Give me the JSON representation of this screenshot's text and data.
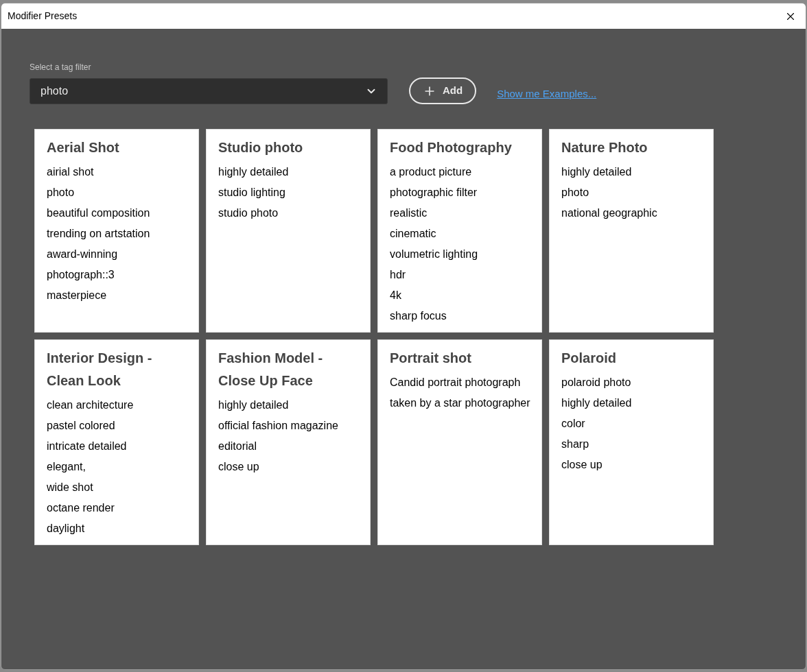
{
  "window": {
    "title": "Modifier Presets"
  },
  "filter": {
    "label": "Select a tag filter",
    "value": "photo"
  },
  "add_button": {
    "label": "Add"
  },
  "examples_link": "Show me Examples...",
  "presets": [
    {
      "title": "Aerial Shot",
      "modifiers": [
        "airial shot",
        "photo",
        "beautiful composition",
        "trending on artstation",
        "award-winning",
        "photograph::3",
        "masterpiece"
      ]
    },
    {
      "title": "Studio photo",
      "modifiers": [
        "highly detailed",
        "studio lighting",
        "studio photo"
      ]
    },
    {
      "title": "Food Photography",
      "modifiers": [
        "a product picture",
        "photographic filter",
        "realistic",
        "cinematic",
        "volumetric lighting",
        "hdr",
        "4k",
        "sharp focus"
      ]
    },
    {
      "title": "Nature Photo",
      "modifiers": [
        "highly detailed",
        "photo",
        "national geographic"
      ]
    },
    {
      "title": "Interior Design - Clean Look",
      "modifiers": [
        "clean architecture",
        "pastel colored",
        "intricate detailed",
        "elegant,",
        "wide shot",
        "octane render",
        "daylight"
      ]
    },
    {
      "title": "Fashion Model - Close Up Face",
      "modifiers": [
        "highly detailed",
        "official fashion magazine",
        "editorial",
        "close up"
      ]
    },
    {
      "title": "Portrait shot",
      "modifiers": [
        "Candid portrait photograph",
        "taken by a star photographer"
      ]
    },
    {
      "title": "Polaroid",
      "modifiers": [
        "polaroid photo",
        "highly detailed",
        "color",
        "sharp",
        "close up"
      ]
    }
  ]
}
